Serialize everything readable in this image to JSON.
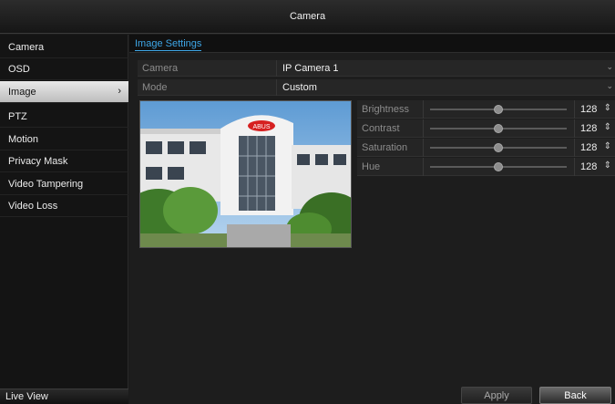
{
  "window": {
    "title": "Camera"
  },
  "sidebar": {
    "items": [
      {
        "label": "Camera"
      },
      {
        "label": "OSD"
      },
      {
        "label": "Image",
        "active": true
      },
      {
        "label": "PTZ"
      },
      {
        "label": "Motion"
      },
      {
        "label": "Privacy Mask"
      },
      {
        "label": "Video Tampering"
      },
      {
        "label": "Video Loss"
      }
    ],
    "footer_label": "Live View"
  },
  "tabs": {
    "active": "Image Settings"
  },
  "settings": {
    "camera_label": "Camera",
    "camera_value": "IP Camera 1",
    "mode_label": "Mode",
    "mode_value": "Custom"
  },
  "adjustments": [
    {
      "label": "Brightness",
      "value": "128",
      "level": 0.5
    },
    {
      "label": "Contrast",
      "value": "128",
      "level": 0.5
    },
    {
      "label": "Saturation",
      "value": "128",
      "level": 0.5
    },
    {
      "label": "Hue",
      "value": "128",
      "level": 0.5
    }
  ],
  "preview": {
    "sign_text": "ABUS"
  },
  "buttons": {
    "apply": "Apply",
    "back": "Back"
  },
  "icons": {
    "submenu": "chevron-right-icon",
    "dropdown": "dropdown-arrow-icon",
    "spinner": "spinner-updown-icon"
  },
  "colors": {
    "accent": "#3ea6e6",
    "active_item": "#d8d8d8"
  }
}
